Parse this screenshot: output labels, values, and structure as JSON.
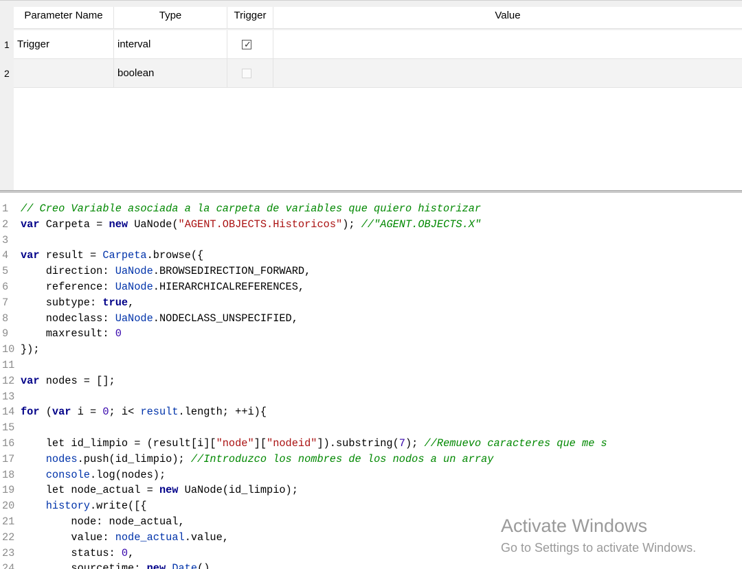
{
  "table": {
    "headers": {
      "parameter_name": "Parameter Name",
      "type": "Type",
      "trigger": "Trigger",
      "value": "Value"
    },
    "rows": [
      {
        "num": "1",
        "name": "Trigger",
        "type": "interval",
        "trigger_checked": true,
        "value": ""
      },
      {
        "num": "2",
        "name": "",
        "type": "boolean",
        "trigger_checked": false,
        "value": ""
      }
    ]
  },
  "editor": {
    "lines": [
      {
        "n": "1",
        "tokens": [
          [
            "cmt",
            "// Creo Variable asociada a la carpeta de variables que quiero historizar"
          ]
        ]
      },
      {
        "n": "2",
        "tokens": [
          [
            "kw",
            "var"
          ],
          [
            "plain",
            " Carpeta = "
          ],
          [
            "kw",
            "new"
          ],
          [
            "plain",
            " UaNode("
          ],
          [
            "str",
            "\"AGENT.OBJECTS.Historicos\""
          ],
          [
            "plain",
            "); "
          ],
          [
            "cmt",
            "//\"AGENT.OBJECTS.X\""
          ]
        ]
      },
      {
        "n": "3",
        "tokens": []
      },
      {
        "n": "4",
        "tokens": [
          [
            "kw",
            "var"
          ],
          [
            "plain",
            " result = "
          ],
          [
            "var",
            "Carpeta"
          ],
          [
            "plain",
            ".browse({"
          ]
        ]
      },
      {
        "n": "5",
        "tokens": [
          [
            "plain",
            "    direction: "
          ],
          [
            "var",
            "UaNode"
          ],
          [
            "plain",
            ".BROWSEDIRECTION_FORWARD,"
          ]
        ]
      },
      {
        "n": "6",
        "tokens": [
          [
            "plain",
            "    reference: "
          ],
          [
            "var",
            "UaNode"
          ],
          [
            "plain",
            ".HIERARCHICALREFERENCES,"
          ]
        ]
      },
      {
        "n": "7",
        "tokens": [
          [
            "plain",
            "    subtype: "
          ],
          [
            "kw",
            "true"
          ],
          [
            "plain",
            ","
          ]
        ]
      },
      {
        "n": "8",
        "tokens": [
          [
            "plain",
            "    nodeclass: "
          ],
          [
            "var",
            "UaNode"
          ],
          [
            "plain",
            ".NODECLASS_UNSPECIFIED,"
          ]
        ]
      },
      {
        "n": "9",
        "tokens": [
          [
            "plain",
            "    maxresult: "
          ],
          [
            "num",
            "0"
          ]
        ]
      },
      {
        "n": "10",
        "tokens": [
          [
            "plain",
            "});"
          ]
        ]
      },
      {
        "n": "11",
        "tokens": []
      },
      {
        "n": "12",
        "tokens": [
          [
            "kw",
            "var"
          ],
          [
            "plain",
            " nodes = [];"
          ]
        ]
      },
      {
        "n": "13",
        "tokens": []
      },
      {
        "n": "14",
        "tokens": [
          [
            "kw",
            "for"
          ],
          [
            "plain",
            " ("
          ],
          [
            "kw",
            "var"
          ],
          [
            "plain",
            " i = "
          ],
          [
            "num",
            "0"
          ],
          [
            "plain",
            "; i< "
          ],
          [
            "var",
            "result"
          ],
          [
            "plain",
            ".length; ++i){"
          ]
        ]
      },
      {
        "n": "15",
        "tokens": []
      },
      {
        "n": "16",
        "tokens": [
          [
            "plain",
            "    let id_limpio = (result[i]["
          ],
          [
            "str",
            "\"node\""
          ],
          [
            "plain",
            "]["
          ],
          [
            "str",
            "\"nodeid\""
          ],
          [
            "plain",
            "]).substring("
          ],
          [
            "num",
            "7"
          ],
          [
            "plain",
            "); "
          ],
          [
            "cmt",
            "//Remuevo caracteres que me s"
          ]
        ]
      },
      {
        "n": "17",
        "tokens": [
          [
            "plain",
            "    "
          ],
          [
            "var",
            "nodes"
          ],
          [
            "plain",
            ".push(id_limpio); "
          ],
          [
            "cmt",
            "//Introduzco los nombres de los nodos a un array"
          ]
        ]
      },
      {
        "n": "18",
        "tokens": [
          [
            "plain",
            "    "
          ],
          [
            "var",
            "console"
          ],
          [
            "plain",
            ".log(nodes);"
          ]
        ]
      },
      {
        "n": "19",
        "tokens": [
          [
            "plain",
            "    let node_actual = "
          ],
          [
            "kw",
            "new"
          ],
          [
            "plain",
            " UaNode(id_limpio);"
          ]
        ]
      },
      {
        "n": "20",
        "tokens": [
          [
            "plain",
            "    "
          ],
          [
            "var",
            "history"
          ],
          [
            "plain",
            ".write([{"
          ]
        ]
      },
      {
        "n": "21",
        "tokens": [
          [
            "plain",
            "        node: node_actual,"
          ]
        ]
      },
      {
        "n": "22",
        "tokens": [
          [
            "plain",
            "        value: "
          ],
          [
            "var",
            "node_actual"
          ],
          [
            "plain",
            ".value,"
          ]
        ]
      },
      {
        "n": "23",
        "tokens": [
          [
            "plain",
            "        status: "
          ],
          [
            "num",
            "0"
          ],
          [
            "plain",
            ","
          ]
        ]
      },
      {
        "n": "24",
        "tokens": [
          [
            "plain",
            "        sourcetime: "
          ],
          [
            "kw",
            "new"
          ],
          [
            "plain",
            " "
          ],
          [
            "var",
            "Date"
          ],
          [
            "plain",
            "()"
          ]
        ]
      }
    ]
  },
  "watermark": {
    "title": "Activate Windows",
    "subtitle": "Go to Settings to activate Windows."
  }
}
